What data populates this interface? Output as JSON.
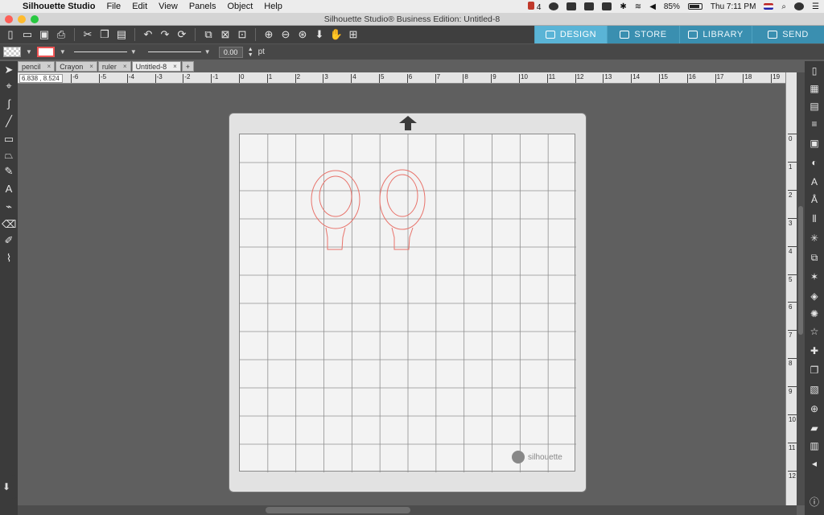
{
  "menubar": {
    "app_name": "Silhouette Studio",
    "menus": [
      "File",
      "Edit",
      "View",
      "Panels",
      "Object",
      "Help"
    ],
    "battery": "85%",
    "clock": "Thu 7:11 PM",
    "notification_count": "4"
  },
  "window": {
    "title": "Silhouette Studio® Business Edition: Untitled-8"
  },
  "nav_tabs": [
    "DESIGN",
    "STORE",
    "LIBRARY",
    "SEND"
  ],
  "stylebar": {
    "line_width": "0.00",
    "unit": "pt"
  },
  "doc_tabs": [
    "pencil",
    "Crayon",
    "ruler",
    "Untitled-8"
  ],
  "coords": "6.838 , 8.524",
  "ruler_top_labels": [
    "-6",
    "-5",
    "-4",
    "-3",
    "-2",
    "-1",
    "0",
    "1",
    "2",
    "3",
    "4",
    "5",
    "6",
    "7",
    "8",
    "9",
    "10",
    "11",
    "12",
    "13",
    "14",
    "15",
    "16",
    "17",
    "18",
    "19"
  ],
  "ruler_left_labels": [
    "0",
    "1",
    "2",
    "3",
    "4",
    "5",
    "6",
    "7",
    "8",
    "9",
    "10",
    "11",
    "12"
  ],
  "mat": {
    "logo": "silhouette"
  },
  "colors": {
    "accent": "#5ab4d6",
    "cut_line": "#e8736b"
  }
}
